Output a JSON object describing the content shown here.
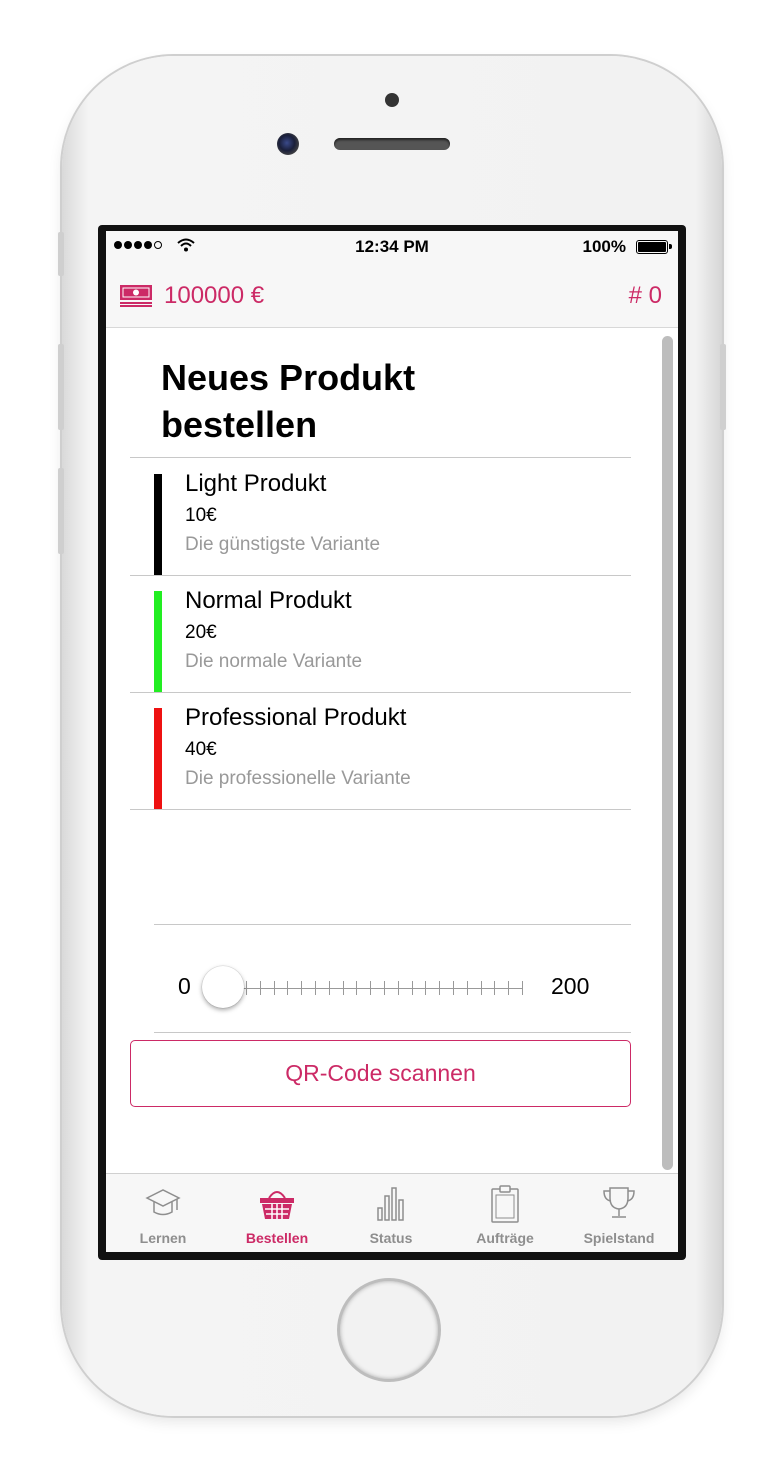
{
  "status_bar": {
    "time": "12:34 PM",
    "battery": "100%"
  },
  "header": {
    "balance": "100000 €",
    "counter": "# 0",
    "money_icon": "money-icon"
  },
  "page": {
    "title": "Neues Produkt bestellen"
  },
  "products": [
    {
      "name": "Light Produkt",
      "price": "10€",
      "description": "Die günstigste Variante",
      "color": "#000000"
    },
    {
      "name": "Normal Produkt",
      "price": "20€",
      "description": "Die normale Variante",
      "color": "#22ee22"
    },
    {
      "name": "Professional Produkt",
      "price": "40€",
      "description": "Die professionelle Variante",
      "color": "#ee1111"
    }
  ],
  "quantity_slider": {
    "min_label": "0",
    "max_label": "200",
    "value": 0
  },
  "qr_button": {
    "label": "QR-Code scannen"
  },
  "tabs": [
    {
      "label": "Lernen",
      "icon": "graduation-cap-icon",
      "active": false
    },
    {
      "label": "Bestellen",
      "icon": "basket-icon",
      "active": true
    },
    {
      "label": "Status",
      "icon": "bar-chart-icon",
      "active": false
    },
    {
      "label": "Aufträge",
      "icon": "clipboard-icon",
      "active": false
    },
    {
      "label": "Spielstand",
      "icon": "trophy-icon",
      "active": false
    }
  ],
  "colors": {
    "accent": "#cc2a66",
    "secondary_text": "#999999"
  }
}
